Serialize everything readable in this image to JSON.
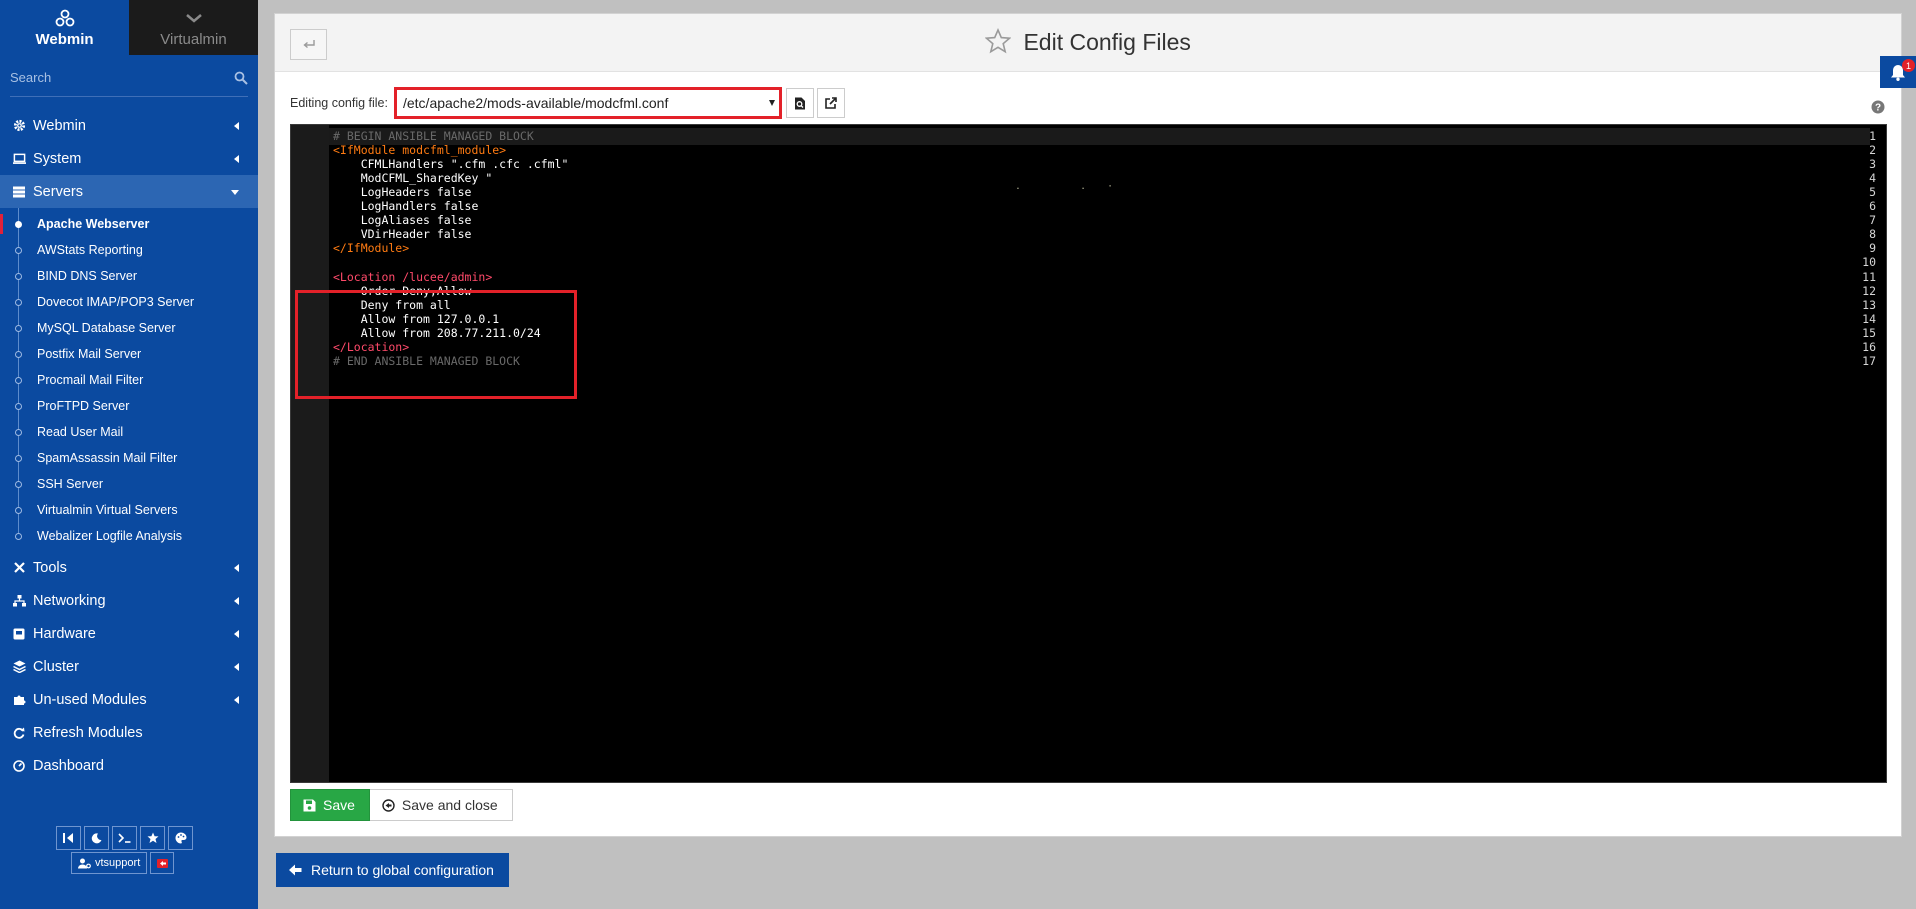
{
  "sidebar": {
    "tabs": [
      {
        "label": "Webmin",
        "icon": "webmin-logo-icon",
        "active": true
      },
      {
        "label": "Virtualmin",
        "icon": "chevron-down-icon",
        "active": false
      }
    ],
    "search": {
      "placeholder": "Search"
    },
    "menu_top": [
      {
        "label": "Webmin",
        "icon": "gear-icon"
      },
      {
        "label": "System",
        "icon": "monitor-icon"
      },
      {
        "label": "Servers",
        "icon": "servers-icon",
        "open": true
      }
    ],
    "servers_items": [
      {
        "label": "Apache Webserver",
        "active": true
      },
      {
        "label": "AWStats Reporting"
      },
      {
        "label": "BIND DNS Server"
      },
      {
        "label": "Dovecot IMAP/POP3 Server"
      },
      {
        "label": "MySQL Database Server"
      },
      {
        "label": "Postfix Mail Server"
      },
      {
        "label": "Procmail Mail Filter"
      },
      {
        "label": "ProFTPD Server"
      },
      {
        "label": "Read User Mail"
      },
      {
        "label": "SpamAssassin Mail Filter"
      },
      {
        "label": "SSH Server"
      },
      {
        "label": "Virtualmin Virtual Servers"
      },
      {
        "label": "Webalizer Logfile Analysis"
      }
    ],
    "menu_bottom": [
      {
        "label": "Tools",
        "icon": "tools-icon",
        "arrow": true
      },
      {
        "label": "Networking",
        "icon": "network-icon",
        "arrow": true
      },
      {
        "label": "Hardware",
        "icon": "hardware-icon",
        "arrow": true
      },
      {
        "label": "Cluster",
        "icon": "layers-icon",
        "arrow": true
      },
      {
        "label": "Un-used Modules",
        "icon": "puzzle-icon",
        "arrow": true
      },
      {
        "label": "Refresh Modules",
        "icon": "refresh-icon",
        "arrow": false
      },
      {
        "label": "Dashboard",
        "icon": "dashboard-icon",
        "arrow": false
      }
    ],
    "user": {
      "name": "vtsupport"
    }
  },
  "header": {
    "title": "Edit Config Files"
  },
  "file_picker": {
    "label": "Editing config file:",
    "selected": "/etc/apache2/mods-available/modcfml.conf"
  },
  "editor": {
    "lines": [
      "# BEGIN ANSIBLE MANAGED BLOCK",
      "<IfModule modcfml_module>",
      "    CFMLHandlers \".cfm .cfc .cfml\"",
      "    ModCFML_SharedKey \"",
      "    LogHeaders false",
      "    LogHandlers false",
      "    LogAliases false",
      "    VDirHeader false",
      "</IfModule>",
      "",
      "<Location /lucee/admin>",
      "    Order Deny,Allow",
      "    Deny from all",
      "    Allow from 127.0.0.1",
      "    Allow from 208.77.211.0/24",
      "</Location>",
      "# END ANSIBLE MANAGED BLOCK"
    ],
    "line_numbers": [
      "1",
      "2",
      "3",
      "4",
      "5",
      "6",
      "7",
      "8",
      "9",
      "10",
      "11",
      "12",
      "13",
      "14",
      "15",
      "16",
      "17"
    ]
  },
  "actions": {
    "save": "Save",
    "save_close": "Save and close",
    "return": "Return to global configuration"
  },
  "notifications": {
    "count": "1"
  },
  "colors": {
    "sidebar_bg": "#0b4aa0",
    "accent_red": "#e32129",
    "save_green": "#28a745",
    "tag_orange": "#ff7b12",
    "tag_red": "#ff4a6a"
  }
}
